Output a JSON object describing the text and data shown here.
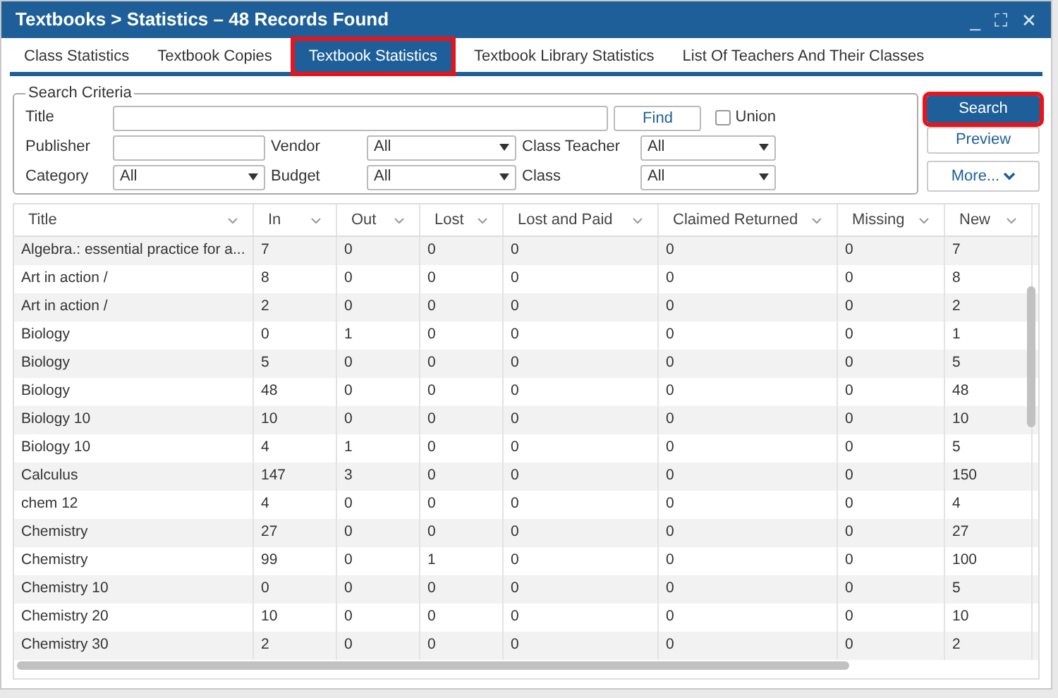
{
  "window": {
    "title": "Textbooks > Statistics – 48 Records Found",
    "controls": [
      "_",
      "⛶",
      "✕"
    ]
  },
  "tabs": [
    {
      "label": "Class Statistics",
      "selected": false,
      "highlighted": false
    },
    {
      "label": "Textbook Copies",
      "selected": false,
      "highlighted": false
    },
    {
      "label": "Textbook Statistics",
      "selected": true,
      "highlighted": true
    },
    {
      "label": "Textbook Library Statistics",
      "selected": false,
      "highlighted": false
    },
    {
      "label": "List Of Teachers And Their Classes",
      "selected": false,
      "highlighted": false
    }
  ],
  "search_criteria": {
    "legend": "Search Criteria",
    "title_label": "Title",
    "find": "Find",
    "union": {
      "label": "Union",
      "checked": false
    },
    "publisher_label": "Publisher",
    "vendor": {
      "label": "Vendor",
      "value": "All"
    },
    "class_teacher": {
      "label": "Class Teacher",
      "value": "All"
    },
    "category": {
      "label": "Category",
      "value": "All"
    },
    "budget": {
      "label": "Budget",
      "value": "All"
    },
    "class": {
      "label": "Class",
      "value": "All"
    }
  },
  "actions": [
    {
      "label": "Search",
      "kind": "primary",
      "highlighted": true
    },
    {
      "label": "Preview",
      "kind": "secondary",
      "highlighted": false
    },
    {
      "label": "More...",
      "kind": "menu",
      "highlighted": false
    }
  ],
  "table": {
    "columns": [
      "Title",
      "In",
      "Out",
      "Lost",
      "Lost and Paid",
      "Claimed Returned",
      "Missing",
      "New"
    ],
    "rows": [
      [
        "Algebra.: essential practice for a...",
        "7",
        "0",
        "0",
        "0",
        "0",
        "0",
        "7"
      ],
      [
        "Art in action /",
        "8",
        "0",
        "0",
        "0",
        "0",
        "0",
        "8"
      ],
      [
        "Art in action /",
        "2",
        "0",
        "0",
        "0",
        "0",
        "0",
        "2"
      ],
      [
        "Biology",
        "0",
        "1",
        "0",
        "0",
        "0",
        "0",
        "1"
      ],
      [
        "Biology",
        "5",
        "0",
        "0",
        "0",
        "0",
        "0",
        "5"
      ],
      [
        "Biology",
        "48",
        "0",
        "0",
        "0",
        "0",
        "0",
        "48"
      ],
      [
        "Biology 10",
        "10",
        "0",
        "0",
        "0",
        "0",
        "0",
        "10"
      ],
      [
        "Biology 10",
        "4",
        "1",
        "0",
        "0",
        "0",
        "0",
        "5"
      ],
      [
        "Calculus",
        "147",
        "3",
        "0",
        "0",
        "0",
        "0",
        "150"
      ],
      [
        "chem 12",
        "4",
        "0",
        "0",
        "0",
        "0",
        "0",
        "4"
      ],
      [
        "Chemistry",
        "27",
        "0",
        "0",
        "0",
        "0",
        "0",
        "27"
      ],
      [
        "Chemistry",
        "99",
        "0",
        "1",
        "0",
        "0",
        "0",
        "100"
      ],
      [
        "Chemistry 10",
        "0",
        "0",
        "0",
        "0",
        "0",
        "0",
        "5"
      ],
      [
        "Chemistry 20",
        "10",
        "0",
        "0",
        "0",
        "0",
        "0",
        "10"
      ],
      [
        "Chemistry 30",
        "2",
        "0",
        "0",
        "0",
        "0",
        "0",
        "2"
      ]
    ]
  }
}
